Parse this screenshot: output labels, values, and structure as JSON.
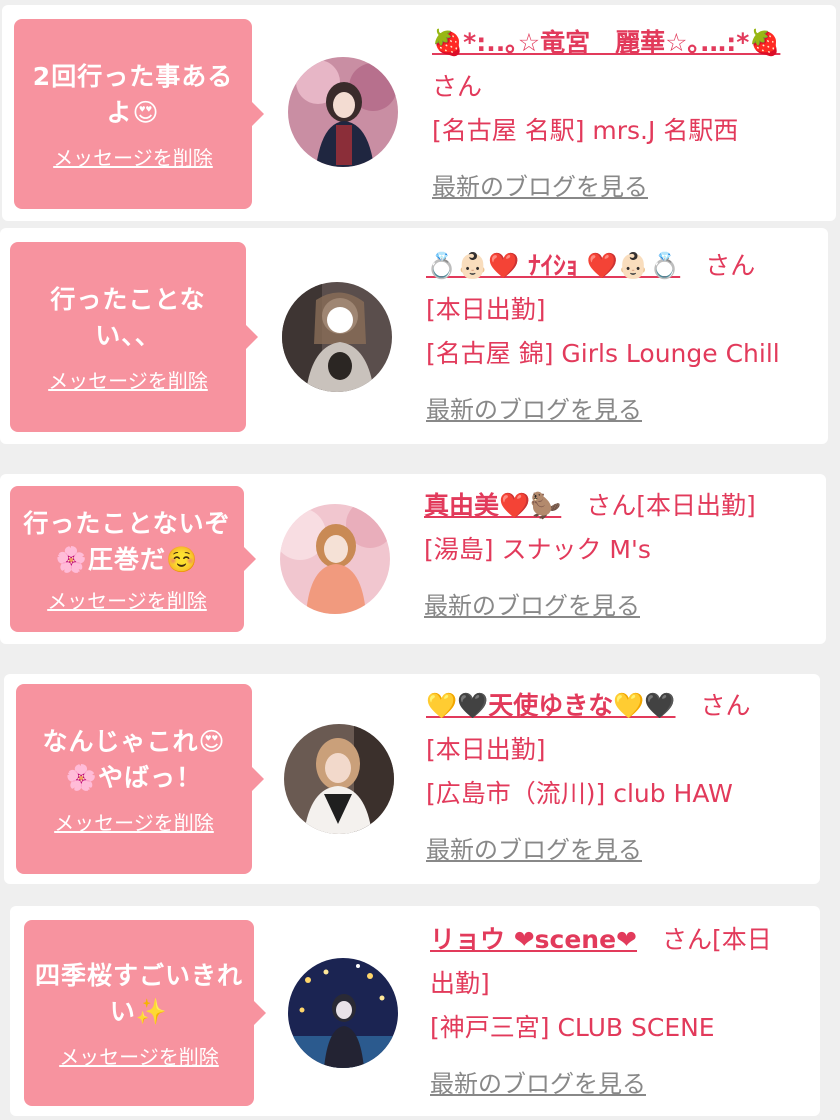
{
  "entries": [
    {
      "message_line1": "2回行った事ある",
      "message_line2": "よ😍",
      "delete_label": "メッセージを削除",
      "name": "🍓*:..｡☆竜宮　麗華☆｡.‥:*🍓",
      "san": "さん",
      "lines": [
        "[名古屋 名駅] mrs.J 名駅西"
      ],
      "blog_label": "最新のブログを見る"
    },
    {
      "message_line1": "行ったことな",
      "message_line2": "い、、",
      "delete_label": "メッセージを削除",
      "name": "💍👶🏻❤️ ﾅｲｼｮ ❤️👶🏻💍",
      "san": "さん",
      "lines": [
        "[本日出勤]",
        "[名古屋 錦] Girls Lounge Chill"
      ],
      "blog_label": "最新のブログを見る"
    },
    {
      "message_line1": "行ったことないぞ",
      "message_line2": "🌸圧巻だ☺️",
      "delete_label": "メッセージを削除",
      "name": "真由美❤️🦫",
      "san": "さん[本日出勤]",
      "lines": [
        "[湯島] スナック M's"
      ],
      "blog_label": "最新のブログを見る"
    },
    {
      "message_line1": "なんじゃこれ😍",
      "message_line2": "🌸やばっ！",
      "delete_label": "メッセージを削除",
      "name": "💛🖤天使ゆきな💛🖤",
      "san": "さん",
      "lines": [
        "[本日出勤]",
        "[広島市（流川)] club HAW"
      ],
      "blog_label": "最新のブログを見る"
    },
    {
      "message_line1": "四季桜すごいきれ",
      "message_line2": "い✨",
      "delete_label": "メッセージを削除",
      "name": "リョウ ❤scene❤",
      "san": "さん[本日",
      "lines": [
        "出勤]",
        "[神戸三宮] CLUB SCENE"
      ],
      "blog_label": "最新のブログを見る"
    }
  ],
  "colors": {
    "bubble": "#f7939f",
    "accent_text": "#e23a5b",
    "link_gray": "#888888",
    "background": "#efefef"
  }
}
